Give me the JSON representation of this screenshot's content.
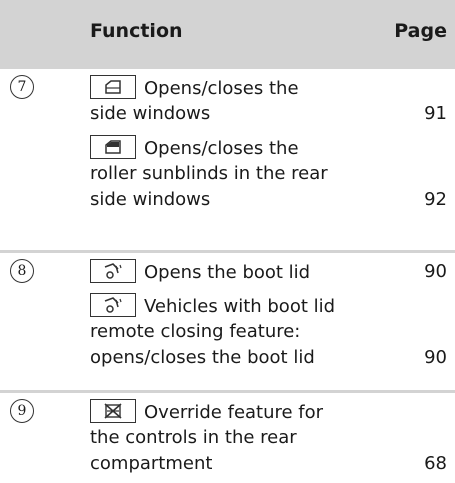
{
  "header": {
    "function": "Function",
    "page": "Page"
  },
  "rows": [
    {
      "num": "7",
      "lines": [
        {
          "icon": "window-icon",
          "text": "Opens/closes the"
        },
        {
          "text": "side windows"
        },
        {
          "icon": "sunblind-icon",
          "text": "Opens/closes the"
        },
        {
          "text": "roller sunblinds in the rear"
        },
        {
          "text": "side windows"
        }
      ],
      "pages": [
        "91",
        "92"
      ]
    },
    {
      "num": "8",
      "lines": [
        {
          "icon": "boot-lid-icon",
          "text": "Opens the boot lid"
        },
        {
          "icon": "boot-lid-icon",
          "text": "Vehicles with boot lid"
        },
        {
          "text": "remote closing feature:"
        },
        {
          "text": "opens/closes the boot lid"
        }
      ],
      "pages": [
        "90",
        "90"
      ]
    },
    {
      "num": "9",
      "lines": [
        {
          "icon": "override-icon",
          "text": "Override feature for"
        },
        {
          "text": "the controls in the rear"
        },
        {
          "text": "compartment"
        }
      ],
      "pages": [
        "68"
      ]
    }
  ]
}
